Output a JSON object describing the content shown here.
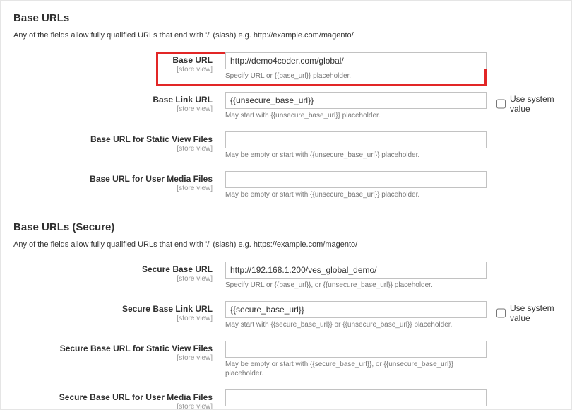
{
  "common": {
    "scope": "[store view]",
    "use_system_value": "Use system value"
  },
  "section_base": {
    "title": "Base URLs",
    "description": "Any of the fields allow fully qualified URLs that end with '/' (slash) e.g. http://example.com/magento/",
    "fields": {
      "base_url": {
        "label": "Base URL",
        "value": "http://demo4coder.com/global/",
        "help": "Specify URL or {{base_url}} placeholder."
      },
      "base_link_url": {
        "label": "Base Link URL",
        "value": "{{unsecure_base_url}}",
        "help": "May start with {{unsecure_base_url}} placeholder."
      },
      "base_url_static": {
        "label": "Base URL for Static View Files",
        "value": "",
        "help": "May be empty or start with {{unsecure_base_url}} placeholder."
      },
      "base_url_media": {
        "label": "Base URL for User Media Files",
        "value": "",
        "help": "May be empty or start with {{unsecure_base_url}} placeholder."
      }
    }
  },
  "section_secure": {
    "title": "Base URLs (Secure)",
    "description": "Any of the fields allow fully qualified URLs that end with '/' (slash) e.g. https://example.com/magento/",
    "fields": {
      "secure_base_url": {
        "label": "Secure Base URL",
        "value": "http://192.168.1.200/ves_global_demo/",
        "help": "Specify URL or {{base_url}}, or {{unsecure_base_url}} placeholder."
      },
      "secure_base_link_url": {
        "label": "Secure Base Link URL",
        "value": "{{secure_base_url}}",
        "help": "May start with {{secure_base_url}} or {{unsecure_base_url}} placeholder."
      },
      "secure_base_url_static": {
        "label": "Secure Base URL for Static View Files",
        "value": "",
        "help": "May be empty or start with {{secure_base_url}}, or {{unsecure_base_url}} placeholder."
      },
      "secure_base_url_media": {
        "label": "Secure Base URL for User Media Files",
        "value": ""
      }
    }
  }
}
